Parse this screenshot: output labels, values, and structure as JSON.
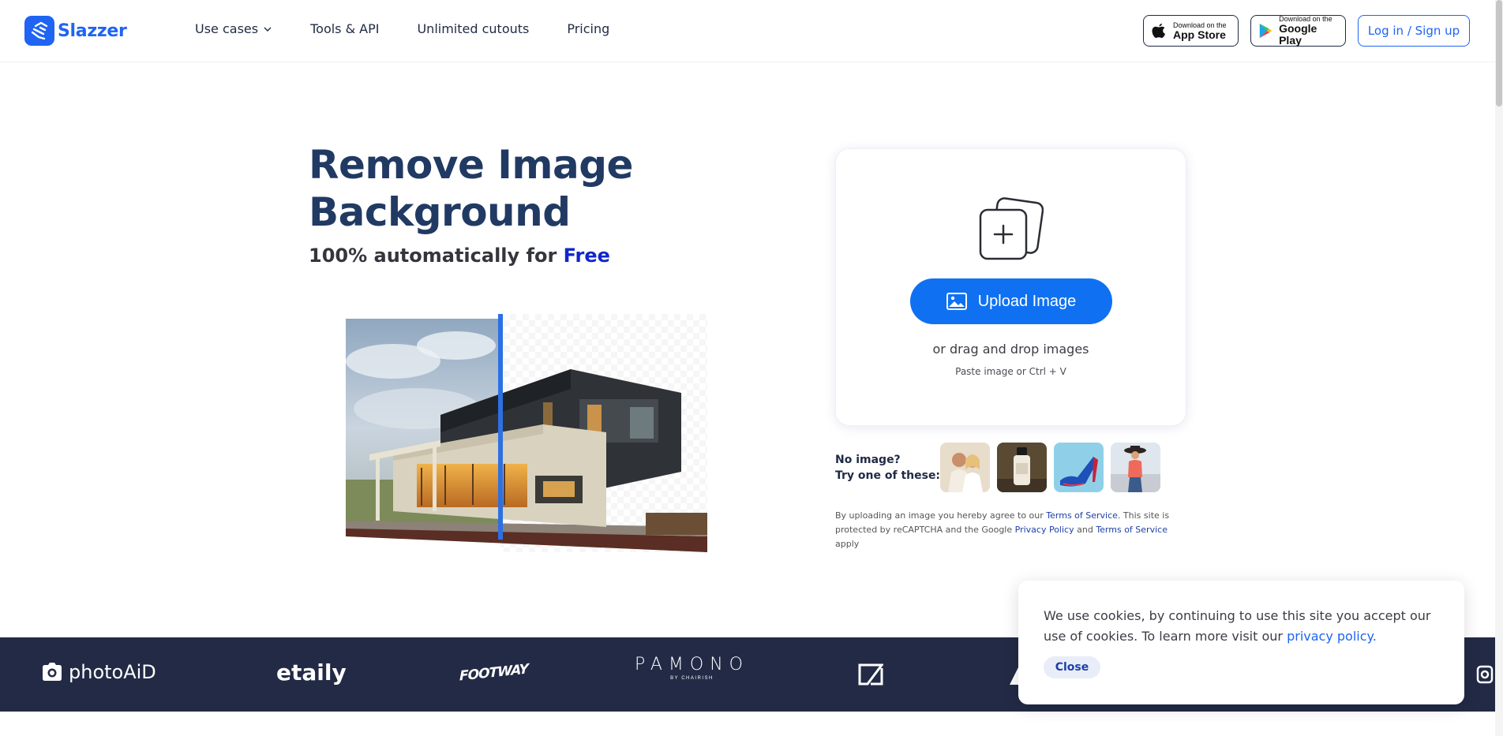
{
  "brand": {
    "name": "Slazzer",
    "color": "#1f64f2"
  },
  "nav": [
    {
      "label": "Use cases",
      "has_dropdown": true
    },
    {
      "label": "Tools & API"
    },
    {
      "label": "Unlimited cutouts"
    },
    {
      "label": "Pricing"
    }
  ],
  "stores": {
    "apple": {
      "small": "Download on the",
      "big": "App Store"
    },
    "google": {
      "small": "Download on the",
      "big": "Google Play"
    }
  },
  "login_label": "Log in / Sign up",
  "hero": {
    "title_line1": "Remove Image",
    "title_line2": "Background",
    "subtitle_prefix": "100% automatically for ",
    "subtitle_highlight": "Free"
  },
  "upload": {
    "button_label": "Upload Image",
    "drag_text": "or drag and drop images",
    "paste_text": "Paste image or Ctrl + V"
  },
  "samples": {
    "label_line1": "No image?",
    "label_line2": "Try one of these:",
    "items": [
      "couple-photo",
      "product-bottle",
      "blue-heel",
      "woman-hat"
    ]
  },
  "legal": {
    "part1": "By uploading an image you hereby agree to our ",
    "tos1": "Terms of Service",
    "part2": ". This site is protected by reCAPTCHA and the Google ",
    "privacy": "Privacy Policy",
    "part3": " and ",
    "tos2": "Terms of Service",
    "part4": " apply"
  },
  "partners": {
    "photoaid": "photoAiD",
    "etaily": "etaily",
    "footway": "FOOTWAY",
    "pamono": "PAMONO",
    "pamono_sub": "BY CHAIRISH"
  },
  "cookie": {
    "text": "We use cookies, by continuing to use this site you accept our use of cookies.  To learn more visit our ",
    "link": "privacy policy.",
    "close": "Close"
  },
  "colors": {
    "navy": "#222a45",
    "title": "#213a63",
    "primary": "#0f71f2",
    "free": "#1027c9"
  }
}
